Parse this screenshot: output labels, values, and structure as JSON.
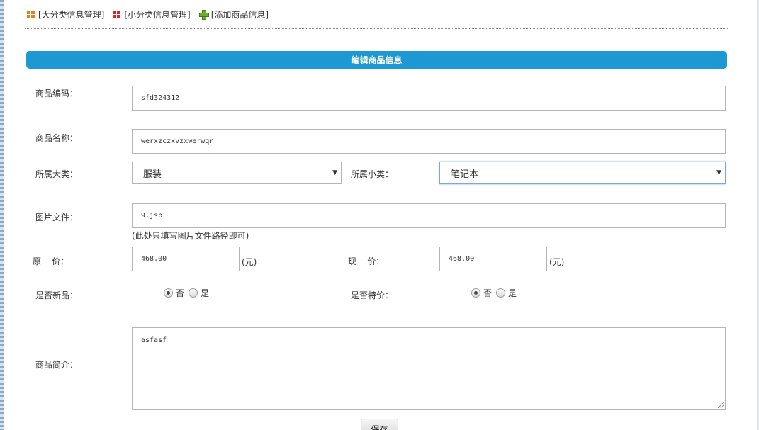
{
  "nav": {
    "links": [
      {
        "label": "[大分类信息管理]",
        "icon": "grid-orange-icon"
      },
      {
        "label": "[小分类信息管理]",
        "icon": "grid-red-icon"
      },
      {
        "label": "[添加商品信息]",
        "icon": "plus-green-icon"
      }
    ]
  },
  "form": {
    "title": "编辑商品信息",
    "code": {
      "label": "商品编码：",
      "value": "sfd324312"
    },
    "name": {
      "label": "商品名称：",
      "value": "werxzczxvzxwerwqr"
    },
    "category": {
      "label": "所属大类：",
      "value": "服装"
    },
    "subcategory": {
      "label": "所属小类：",
      "value": "笔记本"
    },
    "image": {
      "label": "图片文件：",
      "value": "9.jsp",
      "hint": "(此处只填写图片文件路径即可)"
    },
    "original_price": {
      "label": "原    价：",
      "value": "468.00",
      "unit": "(元)"
    },
    "current_price": {
      "label": "现    价：",
      "value": "468.00",
      "unit": "(元)"
    },
    "is_new": {
      "label": "是否新品：",
      "options": [
        "否",
        "是"
      ],
      "selected": "否"
    },
    "is_special": {
      "label": "是否特价：",
      "options": [
        "否",
        "是"
      ],
      "selected": "否"
    },
    "description": {
      "label": "商品简介：",
      "value": "asfasf"
    },
    "save_label": "保存"
  },
  "colors": {
    "accent": "#1e98d3"
  }
}
